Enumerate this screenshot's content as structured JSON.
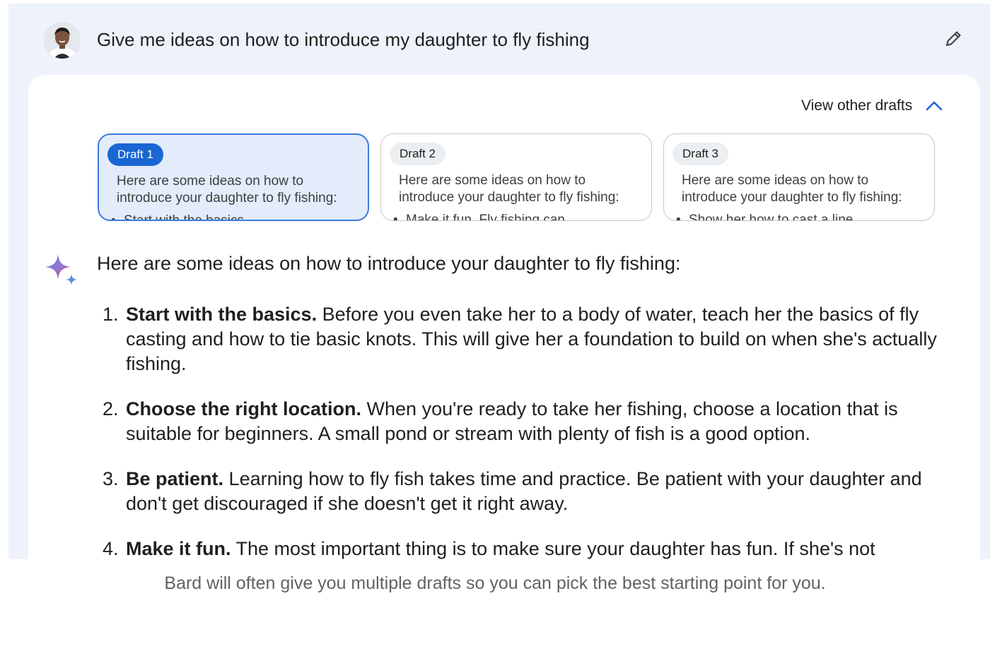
{
  "prompt": {
    "text": "Give me ideas on how to introduce my daughter to fly fishing",
    "avatar_icon": "user-avatar",
    "edit_icon": "pencil-icon"
  },
  "drafts": {
    "toggle_label": "View other drafts",
    "toggle_icon": "chevron-up-icon",
    "items": [
      {
        "label": "Draft 1",
        "preview": "Here are some ideas on how to introduce your daughter to fly fishing:",
        "bullet": "Start with the basics",
        "selected": true
      },
      {
        "label": "Draft 2",
        "preview": "Here are some ideas on how to introduce your daughter to fly fishing:",
        "bullet": "Make it fun. Fly fishing can",
        "selected": false
      },
      {
        "label": "Draft 3",
        "preview": "Here are some ideas on how to introduce your daughter to fly fishing:",
        "bullet": "Show her how to cast a line",
        "selected": false
      }
    ]
  },
  "response": {
    "icon": "sparkle-icon",
    "intro": "Here are some ideas on how to introduce your daughter to fly fishing:",
    "ideas": [
      {
        "num": "1.",
        "title": "Start with the basics.",
        "text": "Before you even take her to a body of water, teach her the basics of fly casting and how to tie basic knots. This will give her a foundation to build on when she's actually fishing."
      },
      {
        "num": "2.",
        "title": "Choose the right location.",
        "text": "When you're ready to take her fishing, choose a location that is suitable for beginners. A small pond or stream with plenty of fish is a good option."
      },
      {
        "num": "3.",
        "title": "Be patient.",
        "text": "Learning how to fly fish takes time and practice. Be patient with your daughter and don't get discouraged if she doesn't get it right away."
      },
      {
        "num": "4.",
        "title": "Make it fun.",
        "text": "The most important thing is to make sure your daughter has fun. If she's not"
      }
    ]
  },
  "caption": "Bard will often give you multiple drafts so you can pick the best starting point for you.",
  "colors": {
    "page_background": "#eef2fb",
    "selected_chip": "#1a66d2",
    "selected_card": "#e3ecfa",
    "accent": "#1a66d2"
  }
}
